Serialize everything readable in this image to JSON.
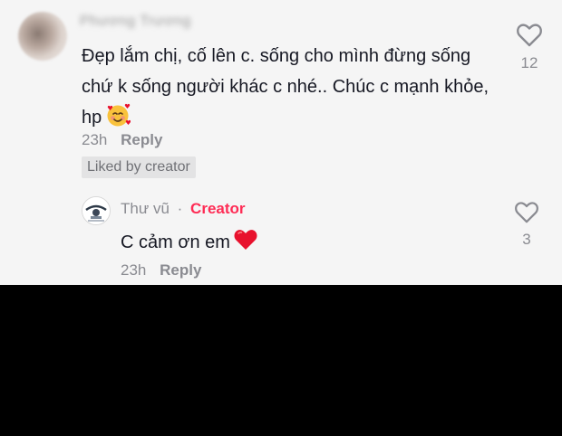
{
  "comment": {
    "username": "Phương Trương",
    "text": "Đẹp lắm chị, cố lên c. sống cho mình đừng sống chứ k sống người khác c nhé.. Chúc c mạnh khỏe, hp",
    "time": "23h",
    "reply_label": "Reply",
    "liked_badge": "Liked by creator",
    "like_count": "12"
  },
  "reply": {
    "username": "Thư vũ",
    "separator": "·",
    "creator_label": "Creator",
    "text": "C cảm ơn em",
    "time": "23h",
    "reply_label": "Reply",
    "like_count": "3"
  },
  "colors": {
    "creator_accent": "#fe2c55",
    "heart_emoji": "#e8112d",
    "muted_text": "#8a8b91",
    "primary_text": "#161823"
  },
  "icons": {
    "like": "heart-outline-icon",
    "emoji_face": "smiling-face-with-hearts-emoji",
    "emoji_heart": "red-heart-emoji"
  }
}
